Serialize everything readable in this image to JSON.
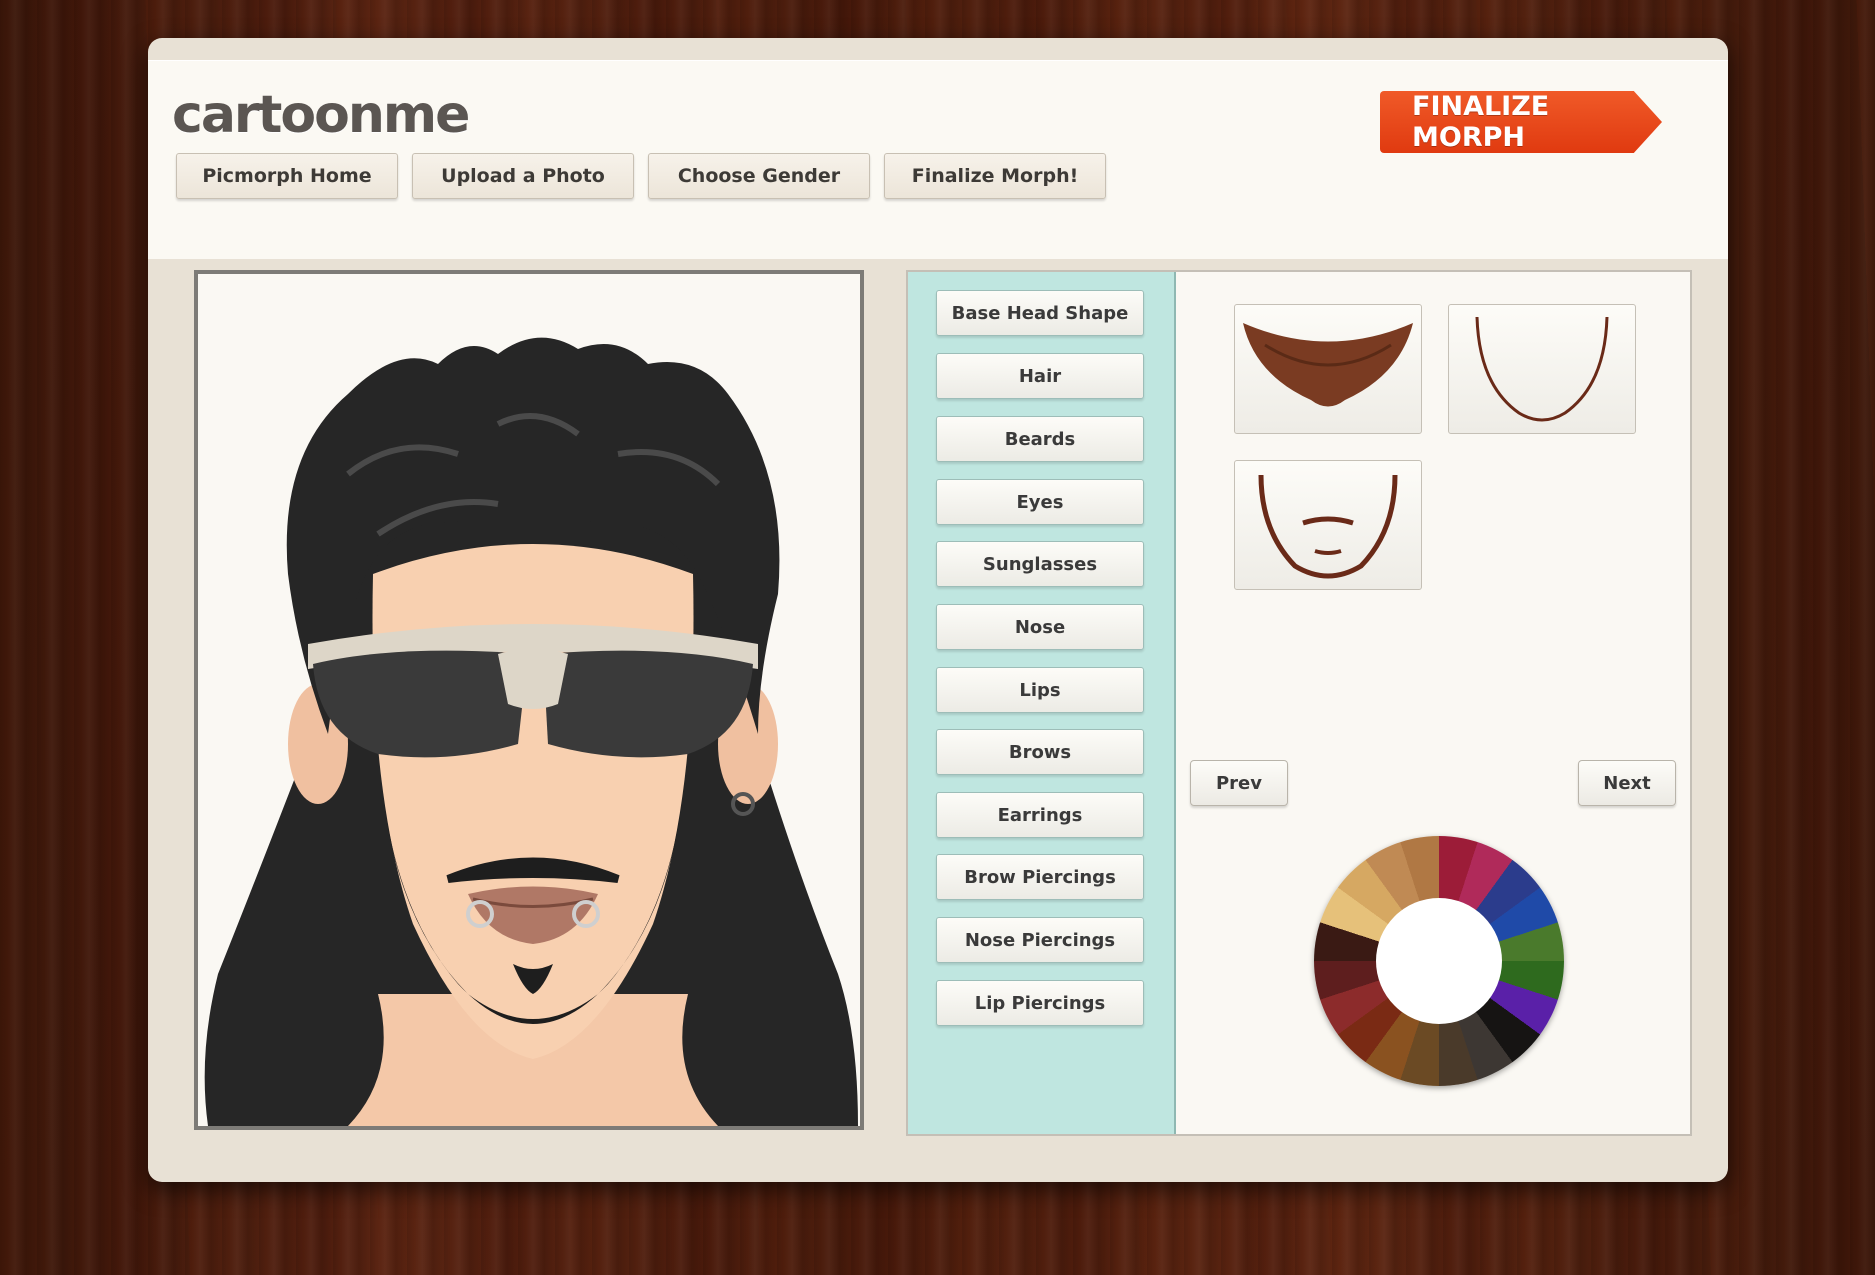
{
  "app": {
    "logo": "cartoonme",
    "finalize_label": "FINALIZE MORPH"
  },
  "nav": {
    "items": [
      {
        "label": "Picmorph Home"
      },
      {
        "label": "Upload a Photo"
      },
      {
        "label": "Choose Gender"
      },
      {
        "label": "Finalize Morph!"
      }
    ]
  },
  "categories": [
    {
      "label": "Base Head Shape"
    },
    {
      "label": "Hair"
    },
    {
      "label": "Beards"
    },
    {
      "label": "Eyes"
    },
    {
      "label": "Sunglasses"
    },
    {
      "label": "Nose"
    },
    {
      "label": "Lips"
    },
    {
      "label": "Brows"
    },
    {
      "label": "Earrings"
    },
    {
      "label": "Brow Piercings"
    },
    {
      "label": "Nose Piercings"
    },
    {
      "label": "Lip Piercings"
    }
  ],
  "pager": {
    "prev_label": "Prev",
    "next_label": "Next"
  },
  "colors": {
    "accent": "#e8461a",
    "category_panel": "#bfe6e0",
    "hair": "#262626",
    "beard_option": "#7a3b22"
  },
  "icons": [
    "goatee-beard-option",
    "chin-strap-beard-option",
    "chin-strap-mustache-beard-option",
    "color-wheel"
  ]
}
